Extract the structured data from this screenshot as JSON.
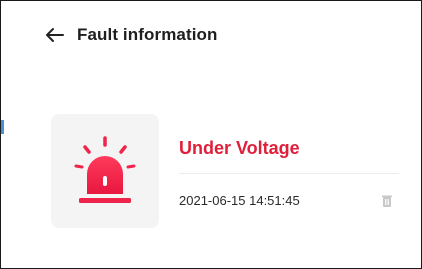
{
  "header": {
    "back_icon": "arrow-left-icon",
    "title": "Fault information"
  },
  "fault": {
    "icon": "alarm-siren-icon",
    "icon_color": "#f0244a",
    "name": "Under Voltage",
    "name_color": "#e0203b",
    "timestamp": "2021-06-15 14:51:45",
    "delete_icon": "trash-icon"
  }
}
